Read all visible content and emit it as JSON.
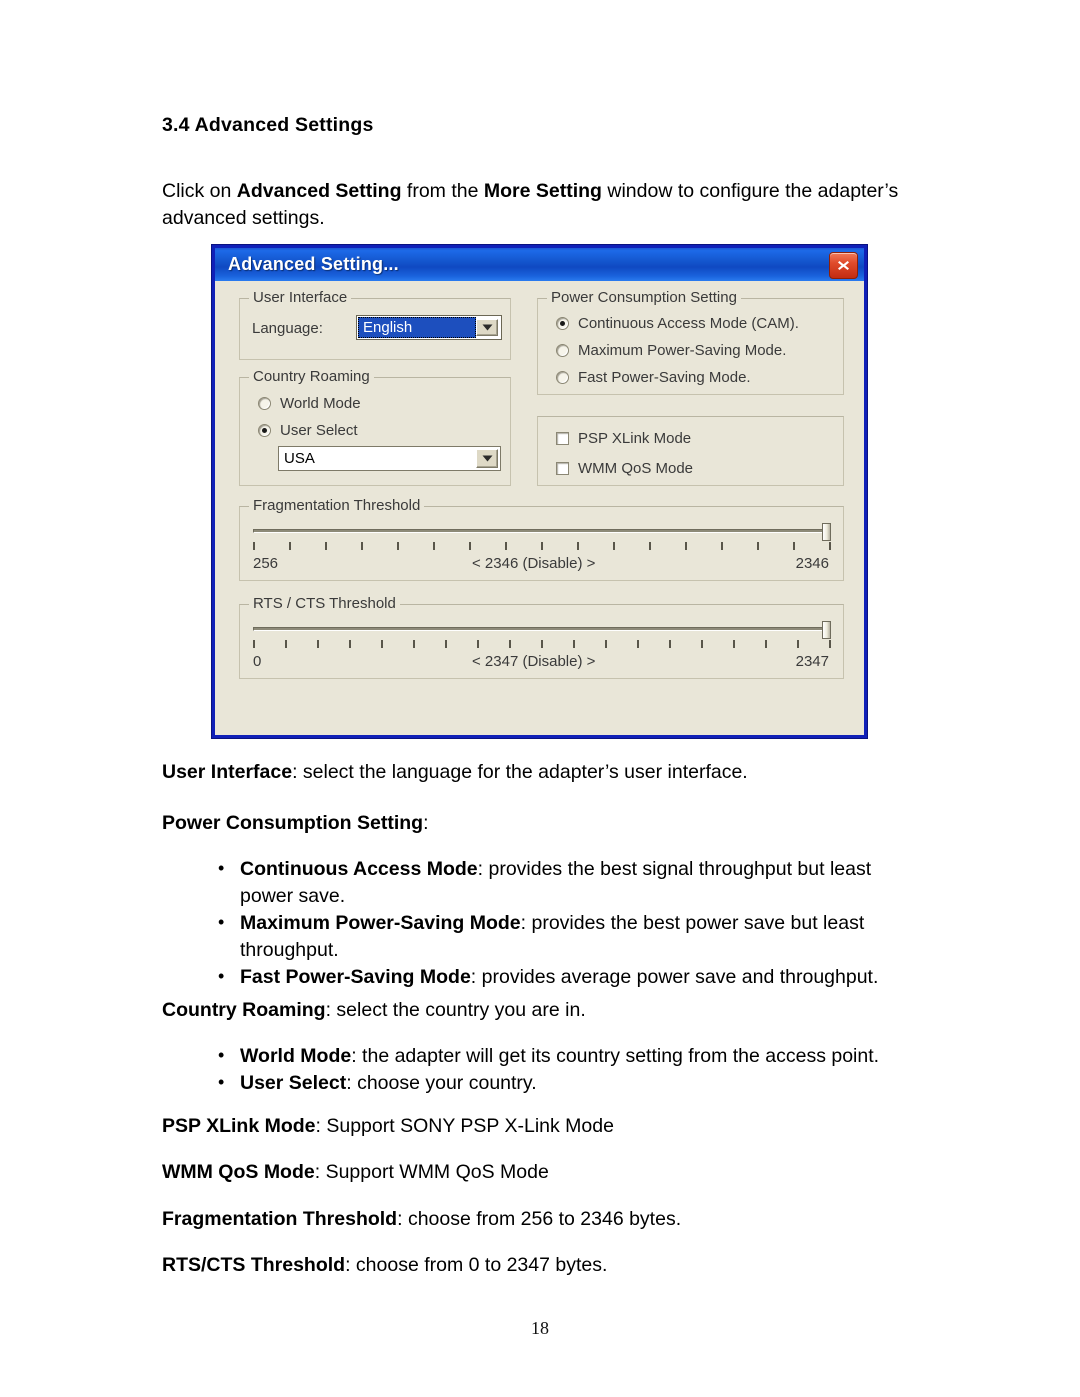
{
  "document": {
    "section_heading": "3.4 Advanced Settings",
    "intro": {
      "part1": "Click on ",
      "bold1": "Advanced Setting",
      "part2": " from the ",
      "bold2": "More Setting",
      "part3": " window to configure the adapter’s advanced settings."
    },
    "user_interface_line": {
      "bold": "User Interface",
      "rest": ": select the language for the adapter’s user interface."
    },
    "power_heading": {
      "bold": "Power Consumption Setting",
      "rest": ":"
    },
    "power_bullets": [
      {
        "bold": "Continuous Access Mode",
        "rest": ": provides the best signal throughput but least power save."
      },
      {
        "bold": "Maximum Power-Saving Mode",
        "rest": ": provides the best power save but least throughput."
      },
      {
        "bold": "Fast Power-Saving Mode",
        "rest": ": provides average power save and throughput."
      }
    ],
    "country_line": {
      "bold": "Country Roaming",
      "rest": ": select the country you are in."
    },
    "country_bullets": [
      {
        "bold": "World Mode",
        "rest": ": the adapter will get its country setting from the access point."
      },
      {
        "bold": "User Select",
        "rest": ": choose your country."
      }
    ],
    "psp_line": {
      "bold": "PSP XLink Mode",
      "rest": ": Support SONY PSP X-Link Mode"
    },
    "wmm_line": {
      "bold": "WMM QoS Mode",
      "rest": ": Support WMM QoS Mode"
    },
    "frag_line": {
      "bold": "Fragmentation Threshold",
      "rest": ": choose from 256 to 2346 bytes."
    },
    "rts_line": {
      "bold": "RTS/CTS Threshold",
      "rest": ": choose from 0 to 2347 bytes."
    },
    "page_number": "18"
  },
  "dialog": {
    "title": "Advanced Setting...",
    "close_label": "✕",
    "user_interface": {
      "group_title": "User Interface",
      "language_label": "Language:",
      "language_value": "English"
    },
    "country_roaming": {
      "group_title": "Country Roaming",
      "world_mode_label": "World Mode",
      "world_mode_selected": false,
      "user_select_label": "User Select",
      "user_select_selected": true,
      "country_value": "USA"
    },
    "power_consumption": {
      "group_title": "Power Consumption Setting",
      "options": [
        {
          "label": "Continuous Access Mode (CAM).",
          "selected": true
        },
        {
          "label": "Maximum Power-Saving Mode.",
          "selected": false
        },
        {
          "label": "Fast Power-Saving Mode.",
          "selected": false
        }
      ]
    },
    "modes": {
      "group_title": "",
      "options": [
        {
          "label": "PSP XLink Mode",
          "checked": false
        },
        {
          "label": "WMM QoS Mode",
          "checked": false
        }
      ]
    },
    "fragmentation": {
      "group_title": "Fragmentation Threshold",
      "min_label": "256",
      "value_label": "< 2346 (Disable) >",
      "max_label": "2346",
      "tick_count": 17,
      "thumb_percent": 100
    },
    "rts_cts": {
      "group_title": "RTS / CTS Threshold",
      "min_label": "0",
      "value_label": "< 2347 (Disable) >",
      "max_label": "2347",
      "tick_count": 19,
      "thumb_percent": 100
    }
  },
  "colors": {
    "titlebar_blue": "#1457cf",
    "dialog_face": "#e9e6d8",
    "border_blue": "#1020b8",
    "close_red": "#c32c12",
    "selection_blue": "#1d4fbe"
  }
}
